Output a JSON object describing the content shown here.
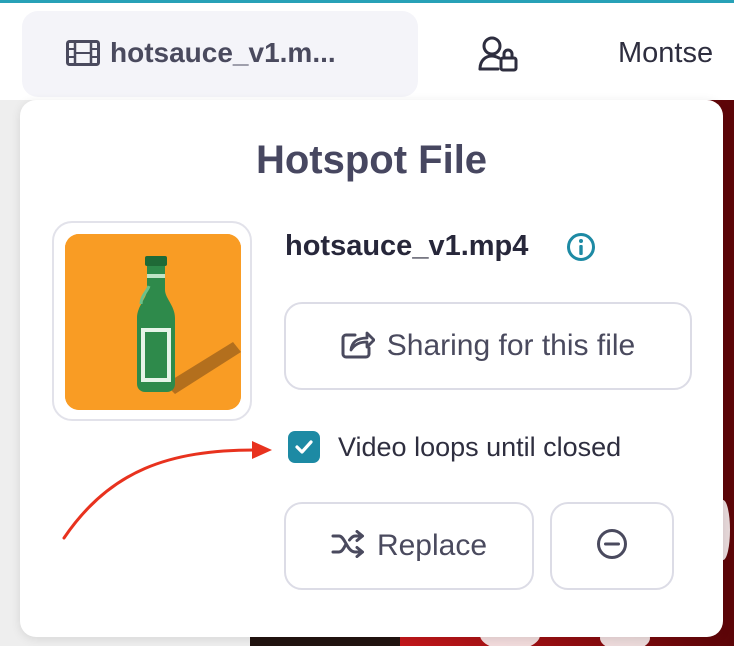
{
  "toolbar": {
    "file_tab_label": "hotsauce_v1.m...",
    "user_name": "Montse"
  },
  "popover": {
    "title": "Hotspot File",
    "file_name": "hotsauce_v1.mp4",
    "share_label": "Sharing for this file",
    "loop_label": "Video loops until closed",
    "loop_checked": true,
    "replace_label": "Replace"
  },
  "icons": {
    "film": "film-icon",
    "user_lock": "user-lock-icon",
    "info": "info-icon",
    "share": "share-icon",
    "shuffle": "shuffle-icon",
    "remove": "minus-circle-icon",
    "check": "check-icon"
  },
  "colors": {
    "accent": "#1d8aa4",
    "top_line": "#27a1b7",
    "thumbnail_bg": "#f99c24",
    "bottle": "#2e8a4b",
    "annotation_arrow": "#e8321e",
    "background_red": "#c7181b"
  }
}
